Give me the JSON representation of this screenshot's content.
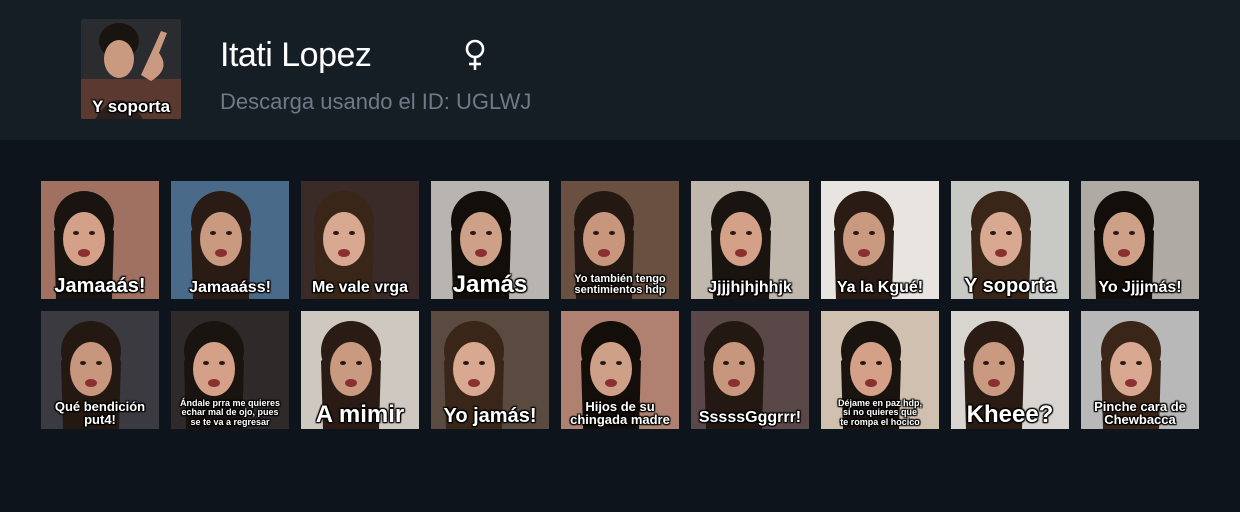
{
  "profile": {
    "name": "Itati Lopez",
    "gender_icon": "female-symbol-icon",
    "download_text": "Descarga usando el ID: UGLWJ",
    "avatar_caption": "Y soporta"
  },
  "stickers": [
    {
      "caption": "Jamaaás!",
      "size": "l",
      "bg": "#a07060"
    },
    {
      "caption": "Jamaaáss!",
      "size": "m",
      "bg": "#4a6a8a"
    },
    {
      "caption": "Me vale vrga",
      "size": "m",
      "bg": "#3a2a28"
    },
    {
      "caption": "Jamás",
      "size": "xl",
      "bg": "#b8b4b0"
    },
    {
      "caption": "Yo también tengo\nsentimientos hdp",
      "size": "xs",
      "bg": "#6a5040"
    },
    {
      "caption": "Jjjjhjhjhhjk",
      "size": "m",
      "bg": "#c0b8ac"
    },
    {
      "caption": "Ya la Kgué!",
      "size": "m",
      "bg": "#e8e4e0"
    },
    {
      "caption": "Y soporta",
      "size": "l",
      "bg": "#c8c8c4"
    },
    {
      "caption": "Yo Jjjjmás!",
      "size": "m",
      "bg": "#b0aaa4"
    },
    {
      "caption": "Qué bendición\nput4!",
      "size": "s",
      "bg": "#3a3a40"
    },
    {
      "caption": "Ándale prra me quieres\nechar mal de ojo, pues\nse te va a regresar",
      "size": "xxs",
      "bg": "#2e2a2a"
    },
    {
      "caption": "A mimir",
      "size": "xl",
      "bg": "#cfc8c0"
    },
    {
      "caption": "Yo jamás!",
      "size": "l",
      "bg": "#5a4a40"
    },
    {
      "caption": "Hijos de su\nchingada madre",
      "size": "s",
      "bg": "#b08070"
    },
    {
      "caption": "SssssGggrrr!",
      "size": "m",
      "bg": "#5a4848"
    },
    {
      "caption": "Déjame en paz hdp,\nsi no quieres que\nte rompa el hocico",
      "size": "xxs",
      "bg": "#d0c0b0"
    },
    {
      "caption": "Kheee?",
      "size": "xl",
      "bg": "#d8d4d0"
    },
    {
      "caption": "Pinche cara de\nChewbacca",
      "size": "s",
      "bg": "#b8b8b8"
    }
  ]
}
